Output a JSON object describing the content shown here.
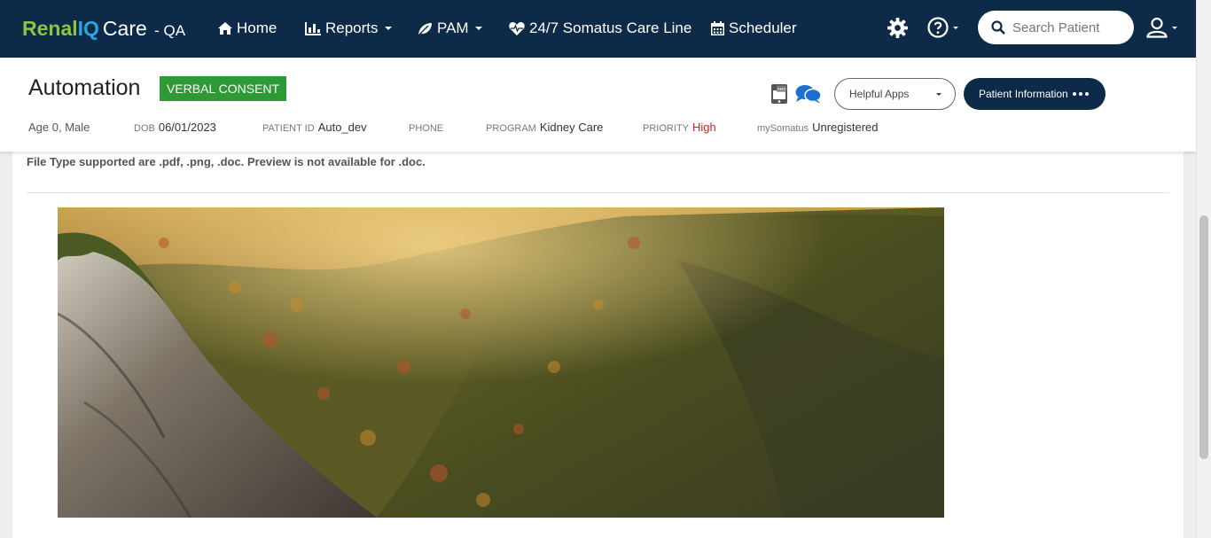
{
  "app": {
    "brand_part1": "Renal",
    "brand_part2": "IQ",
    "brand_care": "Care",
    "brand_env": "- QA"
  },
  "nav": {
    "home": "Home",
    "reports": "Reports",
    "pam": "PAM",
    "care_line": "24/7 Somatus Care Line",
    "scheduler": "Scheduler"
  },
  "search": {
    "placeholder": "Search Patient"
  },
  "patient": {
    "name": "Automation",
    "consent": "VERBAL CONSENT",
    "age_sex": "Age 0, Male",
    "dob_label": "DOB",
    "dob": "06/01/2023",
    "id_label": "PATIENT ID",
    "id": "Auto_dev",
    "phone_label": "PHONE",
    "phone": "",
    "program_label": "PROGRAM",
    "program": "Kidney Care",
    "priority_label": "PRIORITY",
    "priority": "High",
    "mysomatus_label": "mySomatus",
    "mysomatus": "Unregistered"
  },
  "actions": {
    "helpful_apps": "Helpful Apps",
    "patient_information": "Patient Information"
  },
  "content": {
    "file_note": "File Type supported are .pdf, .png, .doc. Preview is not available for .doc."
  },
  "colors": {
    "navbar": "#0d2b48",
    "brand_green": "#8cc63f",
    "brand_blue": "#2aa7e0",
    "consent_green": "#2e9a35",
    "priority_red": "#e01c1c"
  },
  "icons": {
    "home": "home-icon",
    "reports": "bar-chart-icon",
    "pam": "leaf-icon",
    "care_line": "heartbeat-icon",
    "scheduler": "calendar-icon",
    "settings": "gear-icon",
    "help": "question-circle-icon",
    "search": "search-icon",
    "user": "user-icon",
    "sms": "sms-phone-icon",
    "chat": "chat-bubbles-icon"
  }
}
